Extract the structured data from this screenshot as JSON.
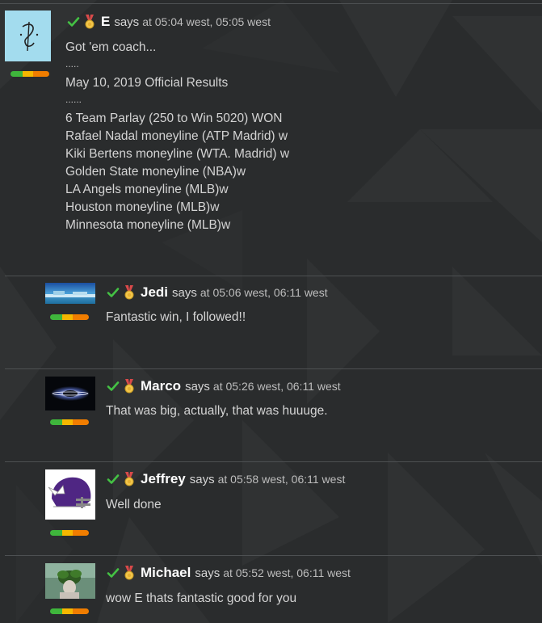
{
  "colors": {
    "check": "#44c244",
    "author": "#ffffff",
    "rating": [
      "#3fb63c",
      "#f5b700",
      "#f07d00"
    ]
  },
  "icons": {
    "verified": "check-icon",
    "badge": "medal-icon"
  },
  "main_post": {
    "author": "E",
    "says": "says",
    "time": "at 05:04 west, 05:05 west",
    "lines": [
      "Got 'em coach...",
      ".....",
      "May 10, 2019 Official Results",
      "......",
      "6 Team Parlay (250 to Win 5020) WON",
      "Rafael Nadal moneyline (ATP Madrid) w",
      "Kiki Bertens moneyline (WTA. Madrid) w",
      "Golden State moneyline (NBA)w",
      "LA Angels moneyline (MLB)w",
      "Houston moneyline (MLB)w",
      "Minnesota moneyline (MLB)w"
    ]
  },
  "replies": [
    {
      "author": "Jedi",
      "says": "says",
      "time": "at 05:06 west, 06:11 west",
      "text": "Fantastic win, I followed!!"
    },
    {
      "author": "Marco",
      "says": "says",
      "time": "at 05:26 west, 06:11 west",
      "text": "That was big, actually, that was huuuge."
    },
    {
      "author": "Jeffrey",
      "says": "says",
      "time": "at 05:58 west, 06:11 west",
      "text": "Well done"
    },
    {
      "author": "Michael",
      "says": "says",
      "time": "at 05:52 west, 06:11 west",
      "text": "wow E thats fantastic good for you"
    }
  ]
}
